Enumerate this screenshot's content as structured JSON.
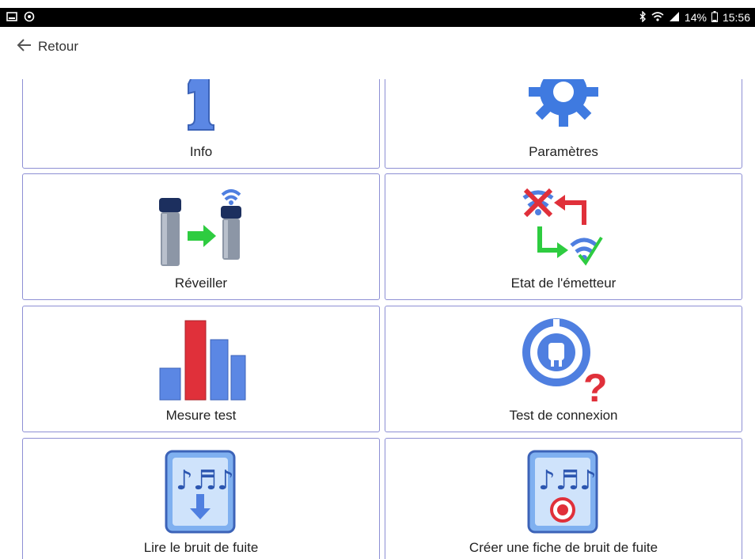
{
  "status_bar": {
    "battery": "14%",
    "time": "15:56",
    "icons": [
      "gallery-icon",
      "sync-icon",
      "bluetooth-icon",
      "wifi-icon",
      "signal-icon",
      "battery-icon"
    ]
  },
  "header": {
    "back_label": "Retour",
    "back_icon": "arrow-left-icon"
  },
  "menu": {
    "items": [
      {
        "label": "Info",
        "icon": "number-one-icon"
      },
      {
        "label": "Paramètres",
        "icon": "gear-icon"
      },
      {
        "label": "Réveiller",
        "icon": "wake-transmitter-icon"
      },
      {
        "label": "Etat de l'émetteur",
        "icon": "transmitter-status-icon"
      },
      {
        "label": "Mesure test",
        "icon": "bar-chart-icon"
      },
      {
        "label": "Test de connexion",
        "icon": "connection-test-icon"
      },
      {
        "label": "Lire le bruit de fuite",
        "icon": "read-leak-noise-icon"
      },
      {
        "label": "Créer une fiche de bruit de fuite",
        "icon": "record-leak-noise-icon"
      }
    ]
  },
  "colors": {
    "tile_border": "#8d8fd4",
    "icon_blue": "#4f7fe0",
    "icon_red": "#e0303a",
    "icon_green": "#2ecc40"
  }
}
